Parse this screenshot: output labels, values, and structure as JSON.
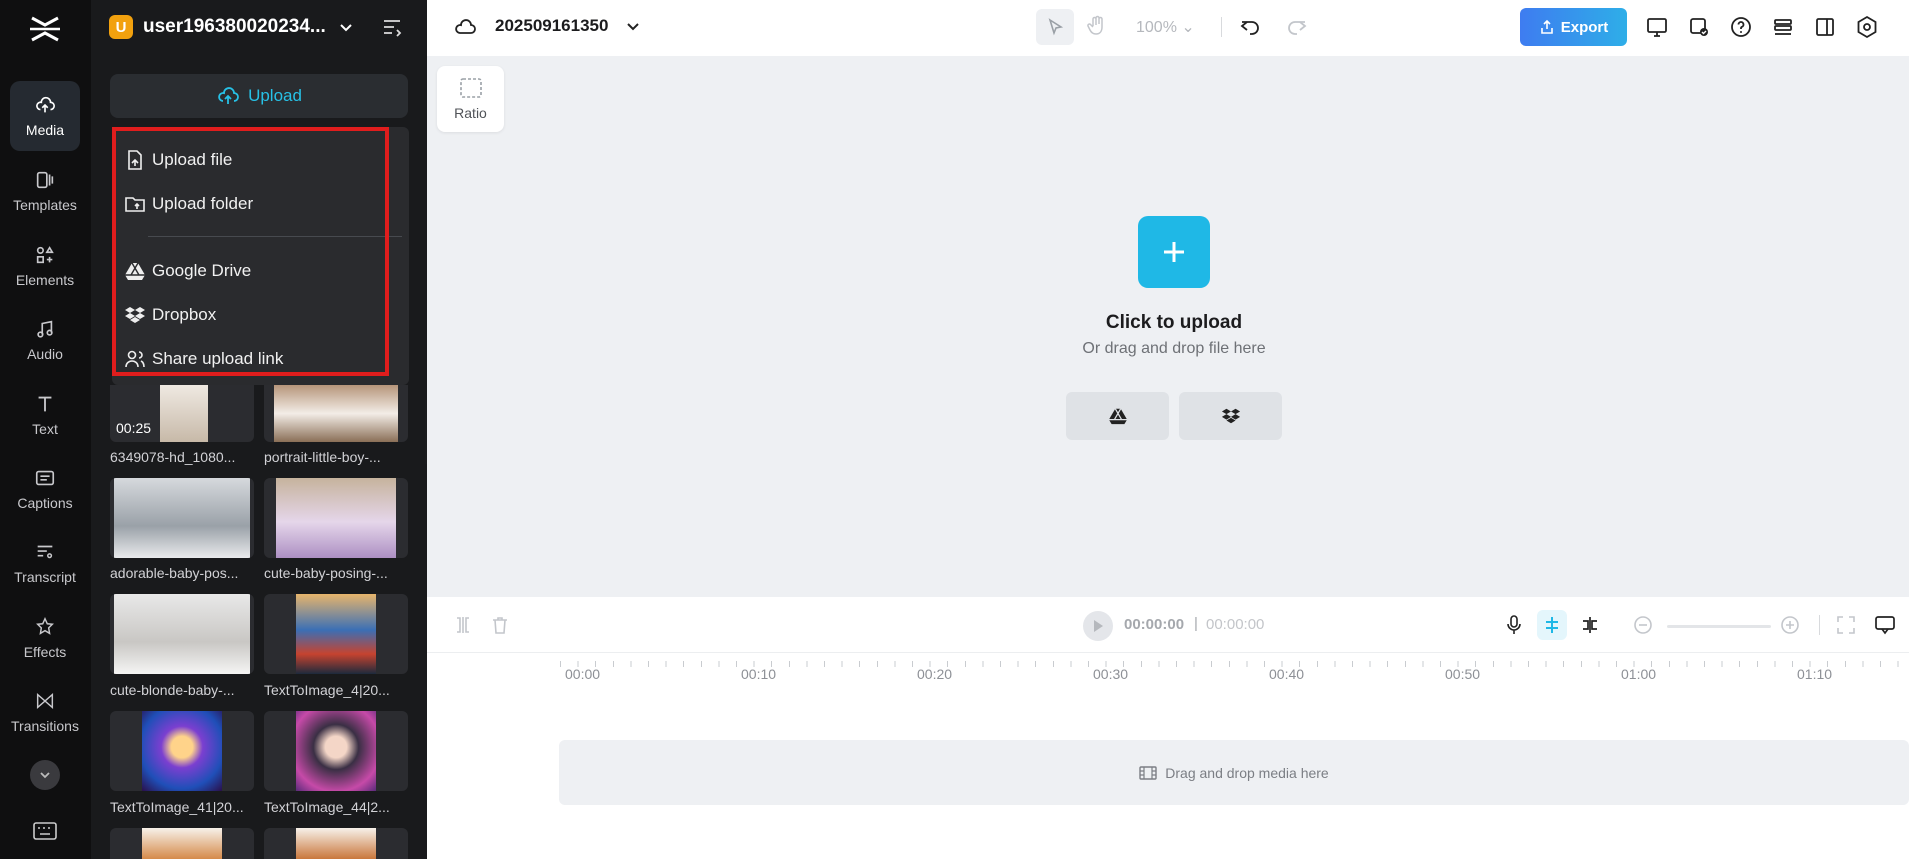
{
  "rail": {
    "items": [
      {
        "label": "Media",
        "icon": "cloud-upload-icon"
      },
      {
        "label": "Templates",
        "icon": "templates-icon"
      },
      {
        "label": "Elements",
        "icon": "elements-icon"
      },
      {
        "label": "Audio",
        "icon": "music-note-icon"
      },
      {
        "label": "Text",
        "icon": "text-icon"
      },
      {
        "label": "Captions",
        "icon": "captions-icon"
      },
      {
        "label": "Transcript",
        "icon": "transcript-icon"
      },
      {
        "label": "Effects",
        "icon": "effects-icon"
      },
      {
        "label": "Transitions",
        "icon": "transitions-icon"
      }
    ]
  },
  "panel": {
    "user_badge": "U",
    "user_name": "user196380020234...",
    "upload_label": "Upload",
    "menu": {
      "upload_file": "Upload file",
      "upload_folder": "Upload folder",
      "google_drive": "Google Drive",
      "dropbox": "Dropbox",
      "share_link": "Share upload link"
    },
    "media": [
      {
        "name": "6349078-hd_1080...",
        "duration": "00:25"
      },
      {
        "name": "portrait-little-boy-..."
      },
      {
        "name": "adorable-baby-pos..."
      },
      {
        "name": "cute-baby-posing-..."
      },
      {
        "name": "cute-blonde-baby-..."
      },
      {
        "name": "TextToImage_4|20..."
      },
      {
        "name": "TextToImage_41|20..."
      },
      {
        "name": "TextToImage_44|2..."
      }
    ]
  },
  "topbar": {
    "project_name": "202509161350",
    "zoom": "100%",
    "export_label": "Export"
  },
  "canvas": {
    "ratio_label": "Ratio",
    "click_to_upload": "Click to upload",
    "or_drag": "Or drag and drop file here"
  },
  "timeline": {
    "current_time": "00:00:00",
    "separator": "|",
    "total_time": "00:00:00",
    "ruler": [
      "00:00",
      "00:10",
      "00:20",
      "00:30",
      "00:40",
      "00:50",
      "01:00",
      "01:10"
    ],
    "drop_hint": "Drag and drop media here"
  },
  "colors": {
    "accent": "#1fb8e6",
    "export_gradient_start": "#3e7cf0",
    "highlight_red": "#e01d1d"
  }
}
